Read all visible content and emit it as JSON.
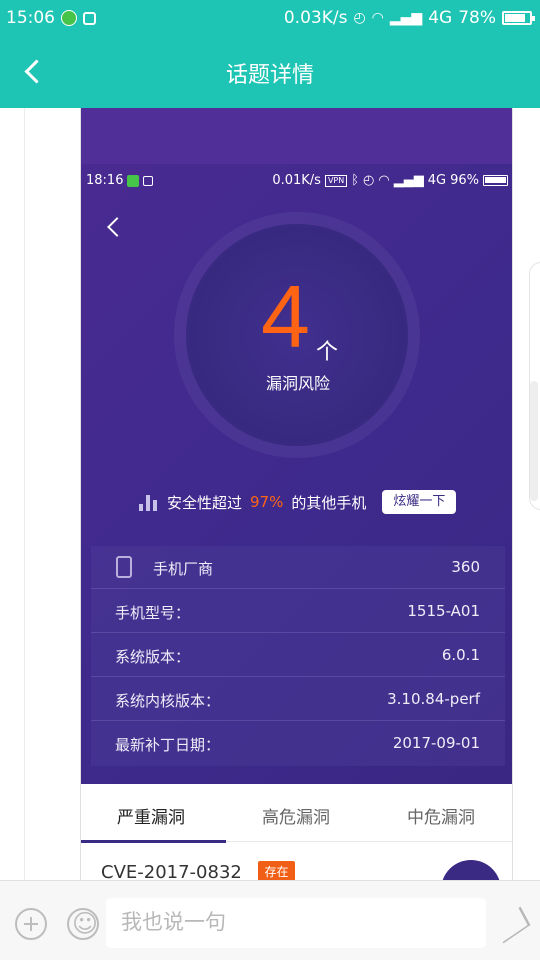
{
  "status_bar": {
    "time": "15:06",
    "speed": "0.03K/s",
    "network": "4G",
    "battery": "78%"
  },
  "header": {
    "title": "话题详情"
  },
  "embedded_screenshot": {
    "status": {
      "time": "18:16",
      "speed": "0.01K/s",
      "vpn": "VPN",
      "network": "4G",
      "battery": "96%"
    },
    "risk_count": "4",
    "risk_unit": "个",
    "risk_label": "漏洞风险",
    "security_text_prefix": "安全性超过",
    "security_percent": "97%",
    "security_text_suffix": "的其他手机",
    "show_off_button": "炫耀一下",
    "device_info": [
      {
        "label": "手机厂商",
        "value": "360"
      },
      {
        "label": "手机型号：",
        "value": "1515-A01"
      },
      {
        "label": "系统版本：",
        "value": "6.0.1"
      },
      {
        "label": "系统内核版本：",
        "value": "3.10.84-perf"
      },
      {
        "label": "最新补丁日期：",
        "value": "2017-09-01"
      }
    ],
    "tabs": [
      {
        "label": "严重漏洞"
      },
      {
        "label": "高危漏洞"
      },
      {
        "label": "中危漏洞"
      }
    ],
    "cve_id": "CVE-2017-0832",
    "cve_status": "存在"
  },
  "comment_bar": {
    "placeholder": "我也说一句"
  },
  "colors": {
    "teal": "#1fc5b4",
    "purple": "#3b2a84",
    "orange": "#ff6414"
  },
  "icons": {
    "back": "back-icon",
    "phone": "phone-icon",
    "bars": "bar-chart-icon",
    "add": "add-icon",
    "emoji": "emoji-icon",
    "send": "send-icon"
  }
}
